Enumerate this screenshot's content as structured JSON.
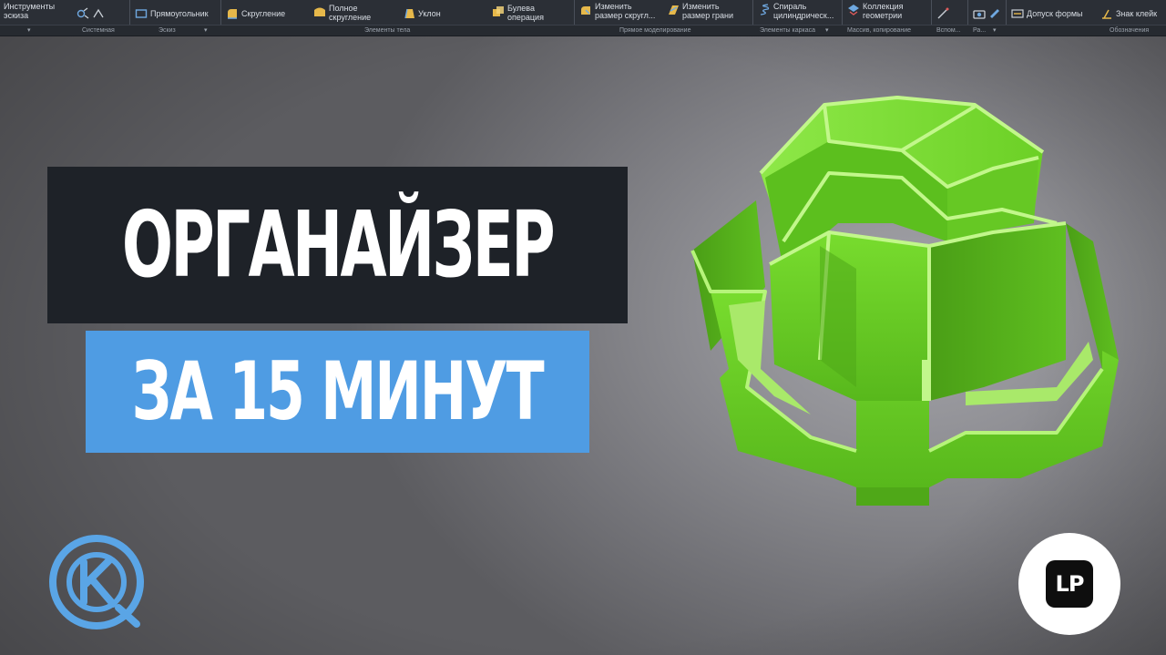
{
  "ribbon": {
    "groups": [
      {
        "name": "Системная",
        "items": [
          {
            "label": "Инструменты\nэскиза"
          }
        ]
      },
      {
        "name": "Эскиз",
        "items": [
          {
            "label": "Прямоугольник"
          }
        ]
      },
      {
        "name": "Элементы тела",
        "items": [
          {
            "label": "Скругление"
          },
          {
            "label": "Полное\nскругление"
          },
          {
            "label": "Уклон"
          },
          {
            "label": "Булева\nоперация"
          }
        ]
      },
      {
        "name": "Прямое моделирование",
        "items": [
          {
            "label": "Изменить\nразмер скругл..."
          },
          {
            "label": "Изменить\nразмер грани"
          }
        ]
      },
      {
        "name": "Элементы каркаса",
        "items": [
          {
            "label": "Спираль\nцилиндрическ..."
          }
        ]
      },
      {
        "name": "Массив, копирование",
        "items": [
          {
            "label": "Коллекция\nгеометрии"
          }
        ]
      },
      {
        "name": "Вспом...",
        "items": []
      },
      {
        "name": "Ра...",
        "items": []
      },
      {
        "name": "Обозначения",
        "items": [
          {
            "label": "Допуск формы"
          },
          {
            "label": "Знак клейк"
          }
        ]
      }
    ]
  },
  "thumbnail": {
    "title": "ОРГАНАЙЗЕР",
    "subtitle": "ЗА 15 МИНУТ",
    "colors": {
      "title_bg": "#1e2228",
      "subtitle_bg": "#4f9ce3",
      "model_green": "#6fd42a",
      "logo_blue": "#5aa5e6"
    }
  },
  "logos": {
    "left": {
      "icon": "kompas-logo-icon",
      "letter": "K"
    },
    "right": {
      "icon": "lp-logo-icon",
      "text": "LP"
    }
  }
}
